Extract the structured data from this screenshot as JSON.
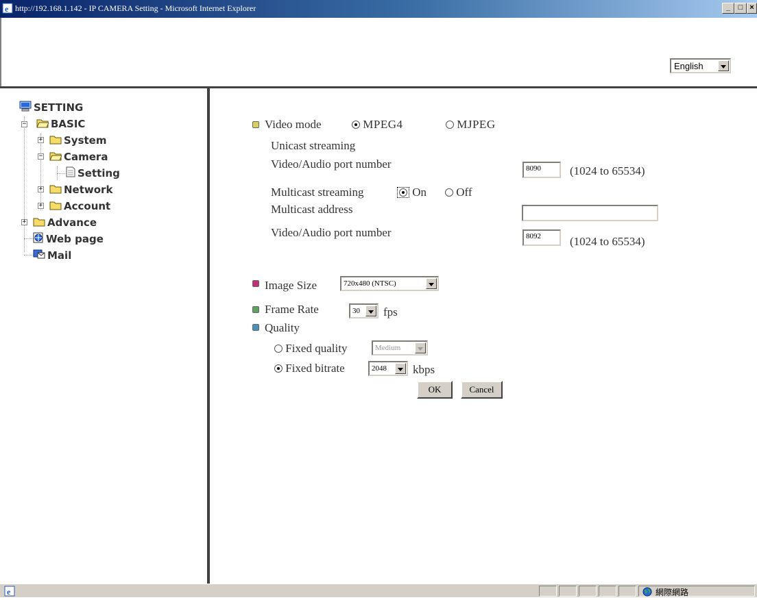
{
  "window": {
    "title": "http://192.168.1.142 - IP CAMERA Setting - Microsoft Internet Explorer",
    "minimize": "_",
    "maximize": "□",
    "close": "×"
  },
  "language": {
    "selected": "English"
  },
  "tree": {
    "root": "SETTING",
    "basic": "BASIC",
    "system": "System",
    "camera": "Camera",
    "setting": "Setting",
    "network": "Network",
    "account": "Account",
    "advance": "Advance",
    "webpage": "Web page",
    "mail": "Mail"
  },
  "video": {
    "label": "Video mode",
    "mpeg4": "MPEG4",
    "mjpeg": "MJPEG",
    "mode_selected": "MPEG4",
    "unicast_label": "Unicast streaming",
    "port_label": "Video/Audio port number",
    "unicast_port": "8090",
    "port_range": "(1024 to 65534)",
    "multicast_label": "Multicast streaming",
    "on": "On",
    "off": "Off",
    "multicast_selected": "On",
    "multicast_address_label": "Multicast address",
    "multicast_address": "",
    "multicast_port_label": "Video/Audio port number",
    "multicast_port": "8092",
    "multicast_port_range": "(1024 to 65534)"
  },
  "image": {
    "size_label": "Image Size",
    "size_value": "720x480 (NTSC)",
    "frame_label": "Frame Rate",
    "frame_value": "30",
    "fps": "fps",
    "quality_label": "Quality",
    "fixed_quality": "Fixed quality",
    "fixed_quality_value": "Medium",
    "fixed_bitrate": "Fixed bitrate",
    "bitrate_value": "2048",
    "kbps": "kbps",
    "quality_mode_selected": "Fixed bitrate"
  },
  "buttons": {
    "ok": "OK",
    "cancel": "Cancel"
  },
  "status": {
    "zone": "網際網路"
  },
  "colors": {
    "bullet_video": "#d8d060",
    "bullet_image": "#c0307a",
    "bullet_frame": "#60a060",
    "bullet_quality": "#4a90b8"
  }
}
